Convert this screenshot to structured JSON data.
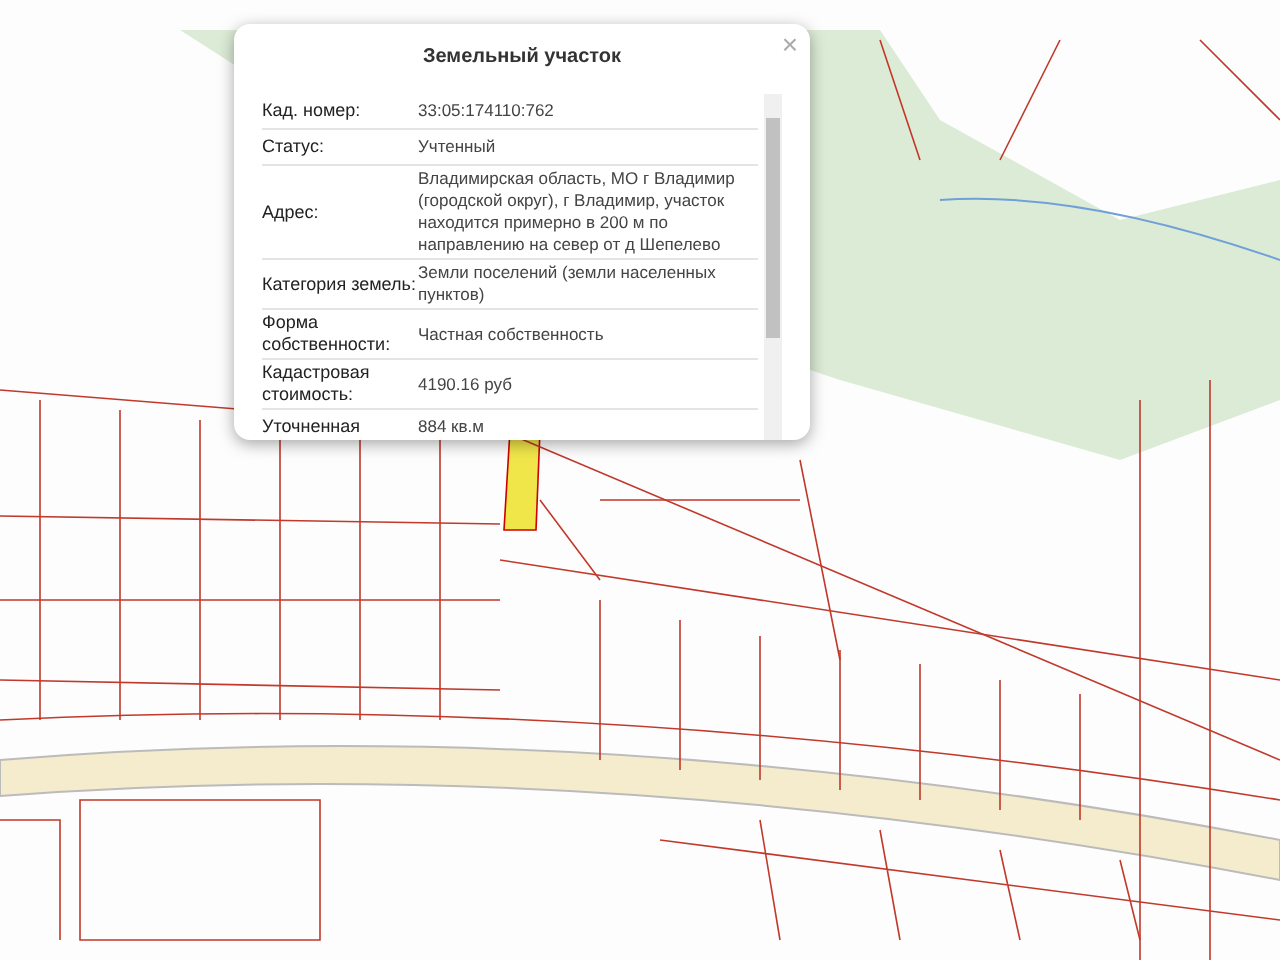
{
  "popup": {
    "title": "Земельный участок",
    "close": "×",
    "rows": [
      {
        "label": "Кад. номер:",
        "value": "33:05:174110:762"
      },
      {
        "label": "Статус:",
        "value": "Учтенный"
      },
      {
        "label": "Адрес:",
        "value": "Владимирская область, МО г Владимир (городской округ), г Владимир, участок находится примерно в 200 м по направлению на север от д Шепелево"
      },
      {
        "label": "Категория земель:",
        "value": "Земли поселений (земли населенных пунктов)"
      },
      {
        "label": "Форма собственности:",
        "value": "Частная собственность"
      },
      {
        "label": "Кадастровая стоимость:",
        "value": "4190.16 руб"
      },
      {
        "label": "Уточненная",
        "value": "884 кв.м"
      }
    ]
  }
}
